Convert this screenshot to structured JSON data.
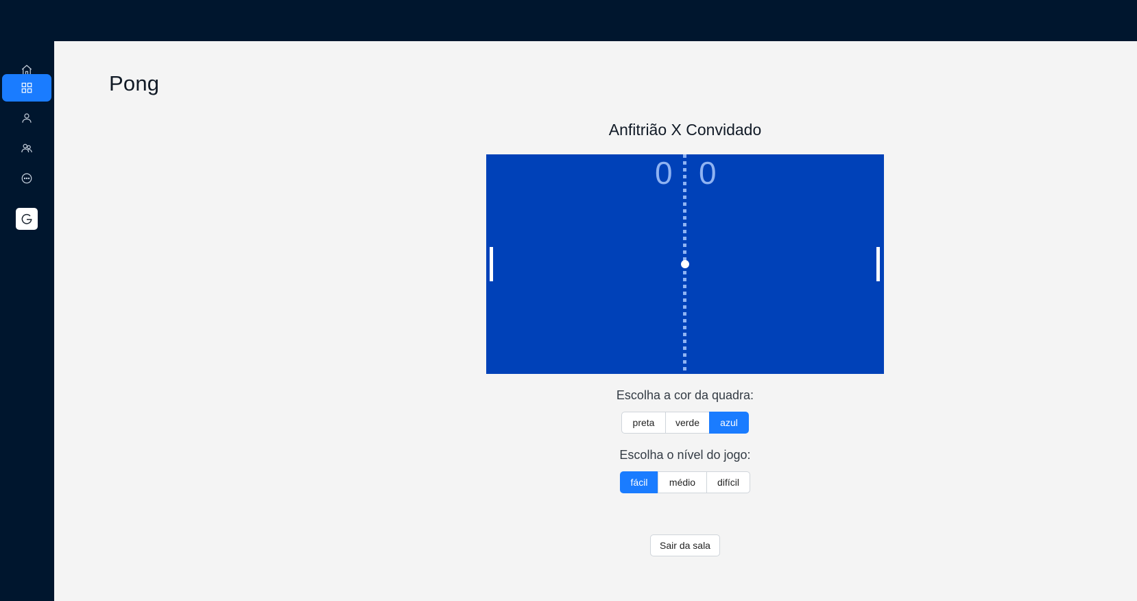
{
  "app": {
    "page_title": "Pong"
  },
  "sidebar": {
    "items": [
      {
        "icon": "home-icon",
        "active": false
      },
      {
        "icon": "dashboard-icon",
        "active": true
      },
      {
        "icon": "user-icon",
        "active": false
      },
      {
        "icon": "users-icon",
        "active": false
      },
      {
        "icon": "chat-icon",
        "active": false
      }
    ],
    "brand_icon": "g-logo-icon"
  },
  "game": {
    "match_title": "Anfitrião X Convidado",
    "score_left": "0",
    "score_right": "0",
    "court_color": "#0041b8"
  },
  "court_color": {
    "label": "Escolha a cor da quadra:",
    "options": [
      "preta",
      "verde",
      "azul"
    ],
    "selected": "azul"
  },
  "level": {
    "label": "Escolha o nível do jogo:",
    "options": [
      "fácil",
      "médio",
      "difícil"
    ],
    "selected": "fácil"
  },
  "actions": {
    "leave_label": "Sair da sala"
  },
  "colors": {
    "sidebar_bg": "#00162e",
    "accent": "#1a7cff"
  }
}
